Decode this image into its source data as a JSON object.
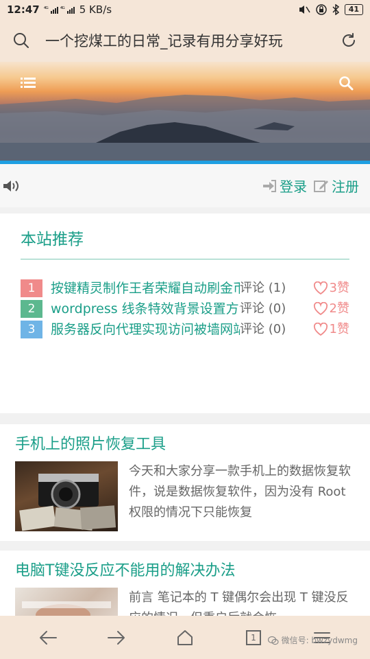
{
  "status_bar": {
    "time": "12:47",
    "signal1": "⁴ᴳ",
    "signal2": "⁴ᴳ",
    "speed": "5 KB/s",
    "battery": "41"
  },
  "address_bar": {
    "title": "一个挖煤工的日常_记录有用分享好玩"
  },
  "login": {
    "login_label": "登录",
    "register_label": "注册"
  },
  "recommend": {
    "heading": "本站推荐",
    "items": [
      {
        "num": "1",
        "color": "#f08a8a",
        "title": "按键精灵制作王者荣耀自动刷金币【初步完结】",
        "comments": "评论 (1)",
        "likes": "3赞"
      },
      {
        "num": "2",
        "color": "#5cb88f",
        "title": "wordpress 线条特效背景设置方法",
        "comments": "评论 (0)",
        "likes": "2赞"
      },
      {
        "num": "3",
        "color": "#6fb4e6",
        "title": "服务器反向代理实现访问被墙网站",
        "comments": "评论 (0)",
        "likes": "1赞"
      }
    ]
  },
  "articles": [
    {
      "title": "手机上的照片恢复工具",
      "excerpt": "今天和大家分享一款手机上的数据恢复软件，说是数据恢复软件，因为没有 Root 权限的情况下只能恢复"
    },
    {
      "title": "电脑T键没反应不能用的解决办法",
      "excerpt": "前言 笔记本的 T 键偶尔会出现 T 键没反应的情况，但重启后就会恢"
    }
  ],
  "bottom_nav": {
    "tab_count": "1"
  },
  "watermark": "微信号: bwzydwmg",
  "colors": {
    "accent": "#1a9e88",
    "hero_bar": "#1f9fe2",
    "like": "#f08a8a"
  }
}
